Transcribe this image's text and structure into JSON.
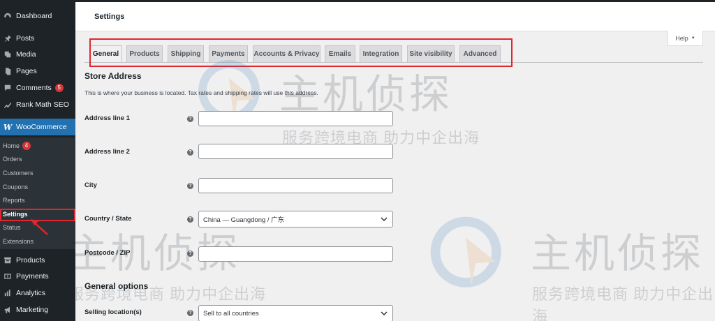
{
  "header": {
    "title": "Settings"
  },
  "help": {
    "label": "Help",
    "caret": "▼"
  },
  "sidebar": {
    "items": [
      {
        "label": "Dashboard",
        "icon": "dashboard-icon"
      },
      {
        "label": "Posts",
        "icon": "pin-icon"
      },
      {
        "label": "Media",
        "icon": "media-icon"
      },
      {
        "label": "Pages",
        "icon": "pages-icon"
      },
      {
        "label": "Comments",
        "icon": "comment-icon",
        "badge": "5"
      },
      {
        "label": "Rank Math SEO",
        "icon": "chart-icon"
      },
      {
        "label": "WooCommerce",
        "icon": "woo-icon"
      },
      {
        "label": "Products",
        "icon": "archive-icon"
      },
      {
        "label": "Payments",
        "icon": "dollar-icon"
      },
      {
        "label": "Analytics",
        "icon": "bar-chart-icon"
      },
      {
        "label": "Marketing",
        "icon": "megaphone-icon"
      }
    ],
    "submenu": [
      {
        "label": "Home",
        "badge": "4"
      },
      {
        "label": "Orders"
      },
      {
        "label": "Customers"
      },
      {
        "label": "Coupons"
      },
      {
        "label": "Reports"
      },
      {
        "label": "Settings"
      },
      {
        "label": "Status"
      },
      {
        "label": "Extensions"
      }
    ]
  },
  "tabs": [
    "General",
    "Products",
    "Shipping",
    "Payments",
    "Accounts & Privacy",
    "Emails",
    "Integration",
    "Site visibility",
    "Advanced"
  ],
  "store": {
    "title": "Store Address",
    "desc": "This is where your business is located. Tax rates and shipping rates will use this address.",
    "fields": [
      {
        "label": "Address line 1",
        "value": ""
      },
      {
        "label": "Address line 2",
        "value": ""
      },
      {
        "label": "City",
        "value": ""
      },
      {
        "label": "Country / State",
        "value": "China — Guangdong / 广东"
      },
      {
        "label": "Postcode / ZIP",
        "value": ""
      }
    ]
  },
  "general": {
    "title": "General options",
    "selling_label": "Selling location(s)",
    "selling_value": "Sell to all countries"
  },
  "help_tip": "?",
  "watermark": {
    "logo": "主机侦探",
    "tagline": "服务跨境电商 助力中企出海"
  },
  "colors": {
    "sidebar": "#1d2327",
    "accent": "#2271b1",
    "highlight": "#e0262f",
    "badge": "#d63638"
  }
}
